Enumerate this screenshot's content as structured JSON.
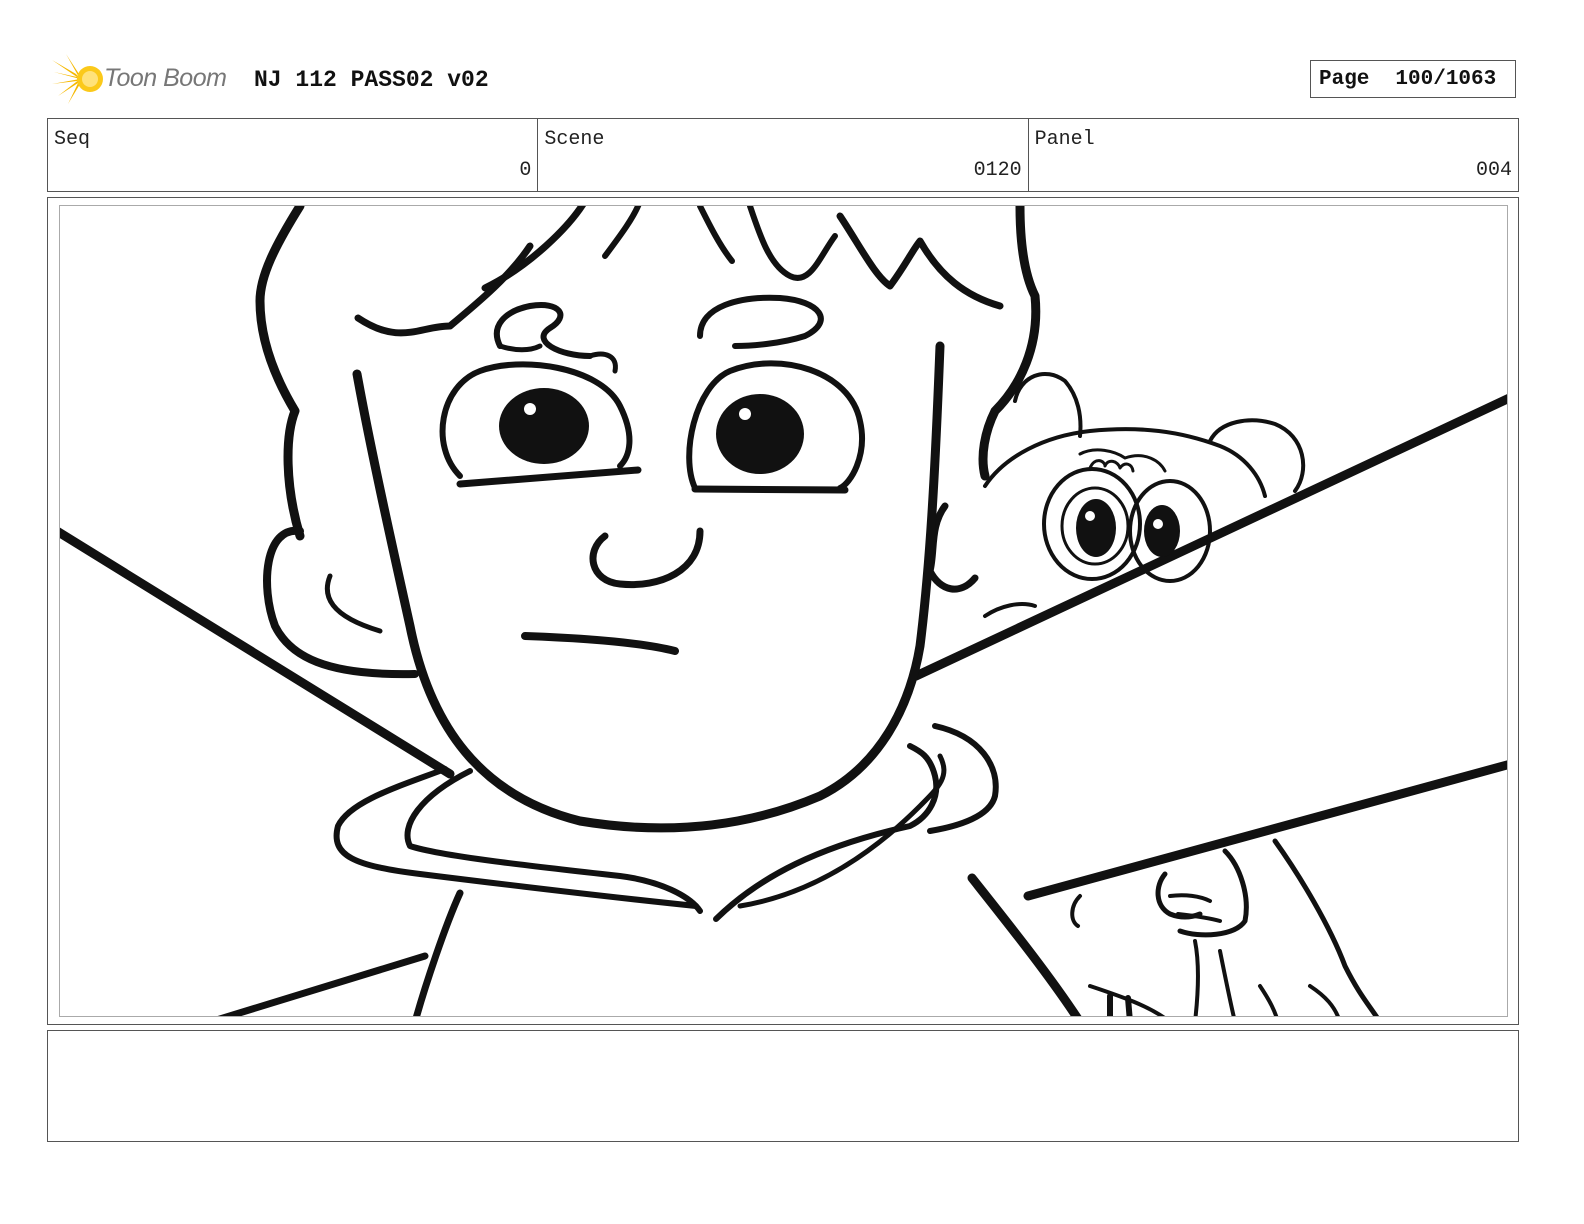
{
  "header": {
    "logo_text": "Toon Boom",
    "project_title": "NJ 112 PASS02 v02",
    "page_label": "Page",
    "page_value": "100/1063"
  },
  "info": {
    "seq_label": "Seq",
    "seq_value": "0",
    "scene_label": "Scene",
    "scene_value": "0120",
    "panel_label": "Panel",
    "panel_value": "004"
  },
  "notes": {
    "text": ""
  },
  "colors": {
    "logo_accent": "#f5b800",
    "ink": "#111111",
    "border": "#555555"
  },
  "icons": {
    "logo": "starburst-logo-icon"
  }
}
